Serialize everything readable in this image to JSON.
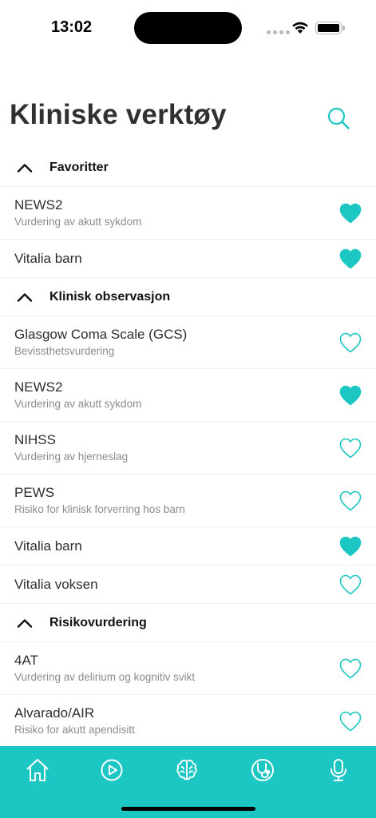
{
  "status_bar": {
    "time": "13:02"
  },
  "header": {
    "title": "Kliniske verktøy"
  },
  "colors": {
    "accent": "#1cc6c2",
    "tab_bar": "#1cc6c2"
  },
  "sections": [
    {
      "title": "Favoritter",
      "expanded": true,
      "items": [
        {
          "title": "NEWS2",
          "subtitle": "Vurdering av akutt sykdom",
          "favorite": true
        },
        {
          "title": "Vitalia barn",
          "subtitle": "",
          "favorite": true
        }
      ]
    },
    {
      "title": "Klinisk observasjon",
      "expanded": true,
      "items": [
        {
          "title": "Glasgow Coma Scale (GCS)",
          "subtitle": "Bevissthetsvurdering",
          "favorite": false
        },
        {
          "title": "NEWS2",
          "subtitle": "Vurdering av akutt sykdom",
          "favorite": true
        },
        {
          "title": "NIHSS",
          "subtitle": "Vurdering av hjerneslag",
          "favorite": false
        },
        {
          "title": "PEWS",
          "subtitle": "Risiko for klinisk forverring hos barn",
          "favorite": false
        },
        {
          "title": "Vitalia barn",
          "subtitle": "",
          "favorite": true
        },
        {
          "title": "Vitalia voksen",
          "subtitle": "",
          "favorite": false
        }
      ]
    },
    {
      "title": "Risikovurdering",
      "expanded": true,
      "items": [
        {
          "title": "4AT",
          "subtitle": "Vurdering av delirium og kognitiv svikt",
          "favorite": false
        },
        {
          "title": "Alvarado/AIR",
          "subtitle": "Risiko for akutt apendisitt",
          "favorite": false
        }
      ]
    }
  ],
  "tab_bar": {
    "tabs": [
      {
        "icon": "home-icon"
      },
      {
        "icon": "play-icon"
      },
      {
        "icon": "brain-icon"
      },
      {
        "icon": "stethoscope-icon"
      },
      {
        "icon": "microphone-icon"
      }
    ]
  }
}
